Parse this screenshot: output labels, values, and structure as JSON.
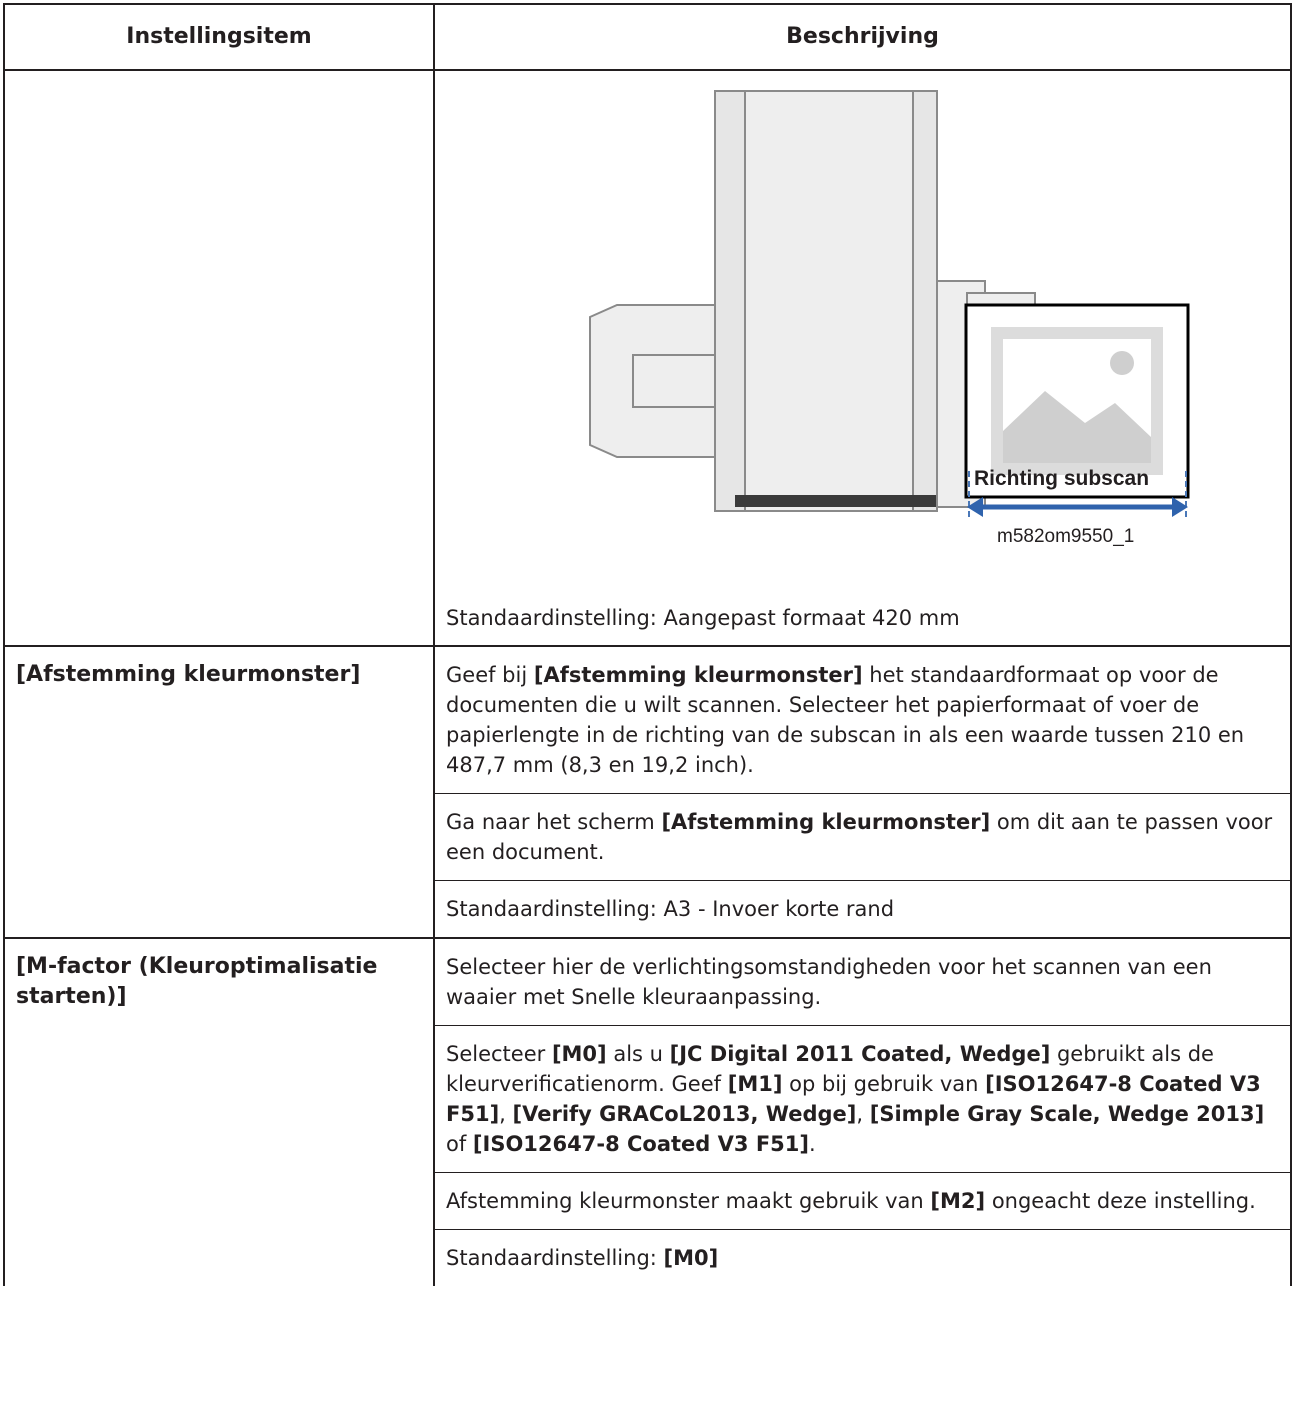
{
  "table": {
    "headers": {
      "item": "Instellingsitem",
      "description": "Beschrijving"
    },
    "row1": {
      "figure_label": "Richting subscan",
      "figure_code": "m582om9550_1",
      "default": "Standaardinstelling: Aangepast formaat 420 mm"
    },
    "row2": {
      "item": "[Afstemming kleurmonster]",
      "p1_a": "Geef bij ",
      "p1_b": "[Afstemming kleurmonster]",
      "p1_c": " het standaardformaat op voor de documenten die u wilt scannen. Selecteer het papierformaat of voer de papierlengte in de richting van de subscan in als een waarde tussen 210 en 487,7 mm (8,3 en 19,2 inch).",
      "p2_a": "Ga naar het scherm ",
      "p2_b": "[Afstemming kleurmonster]",
      "p2_c": " om dit aan te passen voor een document.",
      "default": "Standaardinstelling: A3 - Invoer korte rand"
    },
    "row3": {
      "item": "[M-factor (Kleuroptimalisatie starten)]",
      "p1": "Selecteer hier de verlichtingsomstandigheden voor het scannen van een waaier met Snelle kleuraanpassing.",
      "p2_a": "Selecteer ",
      "p2_b": "[M0]",
      "p2_c": " als u ",
      "p2_d": "[JC Digital 2011 Coated, Wedge]",
      "p2_e": " gebruikt als de kleurverificatienorm. Geef ",
      "p2_f": "[M1]",
      "p2_g": " op bij gebruik van ",
      "p2_h": "[ISO12647-8 Coated V3 F51]",
      "p2_i": ", ",
      "p2_j": "[Verify GRACoL2013, Wedge]",
      "p2_k": ", ",
      "p2_l": "[Simple Gray Scale, Wedge 2013]",
      "p2_m": " of ",
      "p2_n": "[ISO12647-8 Coated V3 F51]",
      "p2_o": ".",
      "p3_a": "Afstemming kleurmonster maakt gebruik van ",
      "p3_b": "[M2]",
      "p3_c": " ongeacht deze instelling.",
      "default_a": "Standaardinstelling: ",
      "default_b": "[M0]"
    }
  }
}
